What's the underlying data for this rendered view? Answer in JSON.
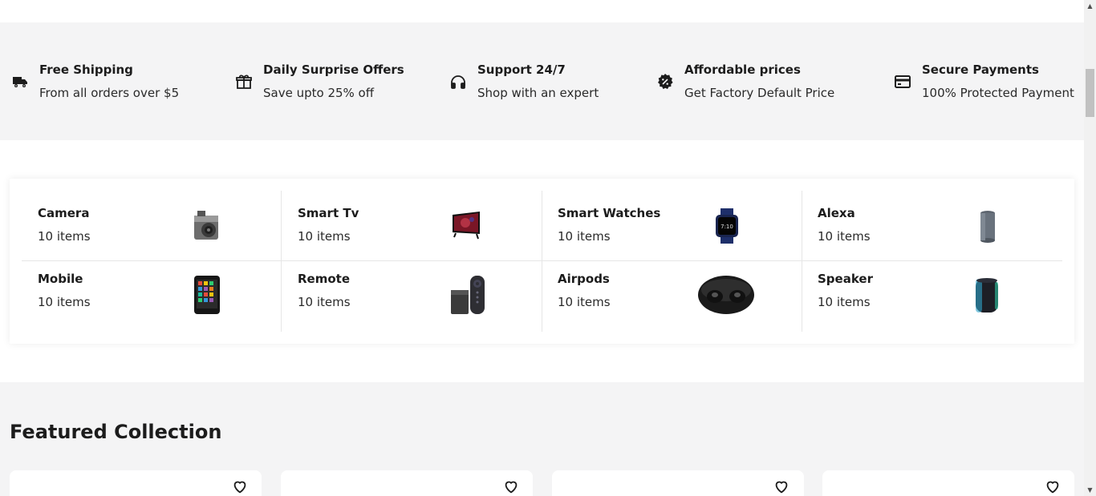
{
  "services": [
    {
      "icon": "truck-icon",
      "title": "Free Shipping",
      "subtitle": "From all orders over $5"
    },
    {
      "icon": "gift-icon",
      "title": "Daily Surprise Offers",
      "subtitle": "Save upto 25% off"
    },
    {
      "icon": "headphones-icon",
      "title": "Support 24/7",
      "subtitle": "Shop with an expert"
    },
    {
      "icon": "discount-badge-icon",
      "title": "Affordable prices",
      "subtitle": "Get Factory Default Price"
    },
    {
      "icon": "credit-card-icon",
      "title": "Secure Payments",
      "subtitle": "100% Protected Payment"
    }
  ],
  "categories": [
    {
      "name": "Camera",
      "count": "10 items",
      "image": "camera-image"
    },
    {
      "name": "Smart Tv",
      "count": "10 items",
      "image": "smart-tv-image"
    },
    {
      "name": "Smart Watches",
      "count": "10 items",
      "image": "smart-watch-image"
    },
    {
      "name": "Alexa",
      "count": "10 items",
      "image": "alexa-speaker-image"
    },
    {
      "name": "Mobile",
      "count": "10 items",
      "image": "mobile-phone-image"
    },
    {
      "name": "Remote",
      "count": "10 items",
      "image": "remote-image"
    },
    {
      "name": "Airpods",
      "count": "10 items",
      "image": "airpods-image"
    },
    {
      "name": "Speaker",
      "count": "10 items",
      "image": "speaker-image"
    }
  ],
  "featured": {
    "title": "Featured Collection",
    "cards": [
      {
        "wishlist_icon": "heart-icon"
      },
      {
        "wishlist_icon": "heart-icon"
      },
      {
        "wishlist_icon": "heart-icon"
      },
      {
        "wishlist_icon": "heart-icon"
      }
    ]
  },
  "watch_display": "7:10",
  "colors": {
    "band_bg": "#f4f4f5",
    "text": "#1c1c1c",
    "divider": "#e6e6e6"
  }
}
